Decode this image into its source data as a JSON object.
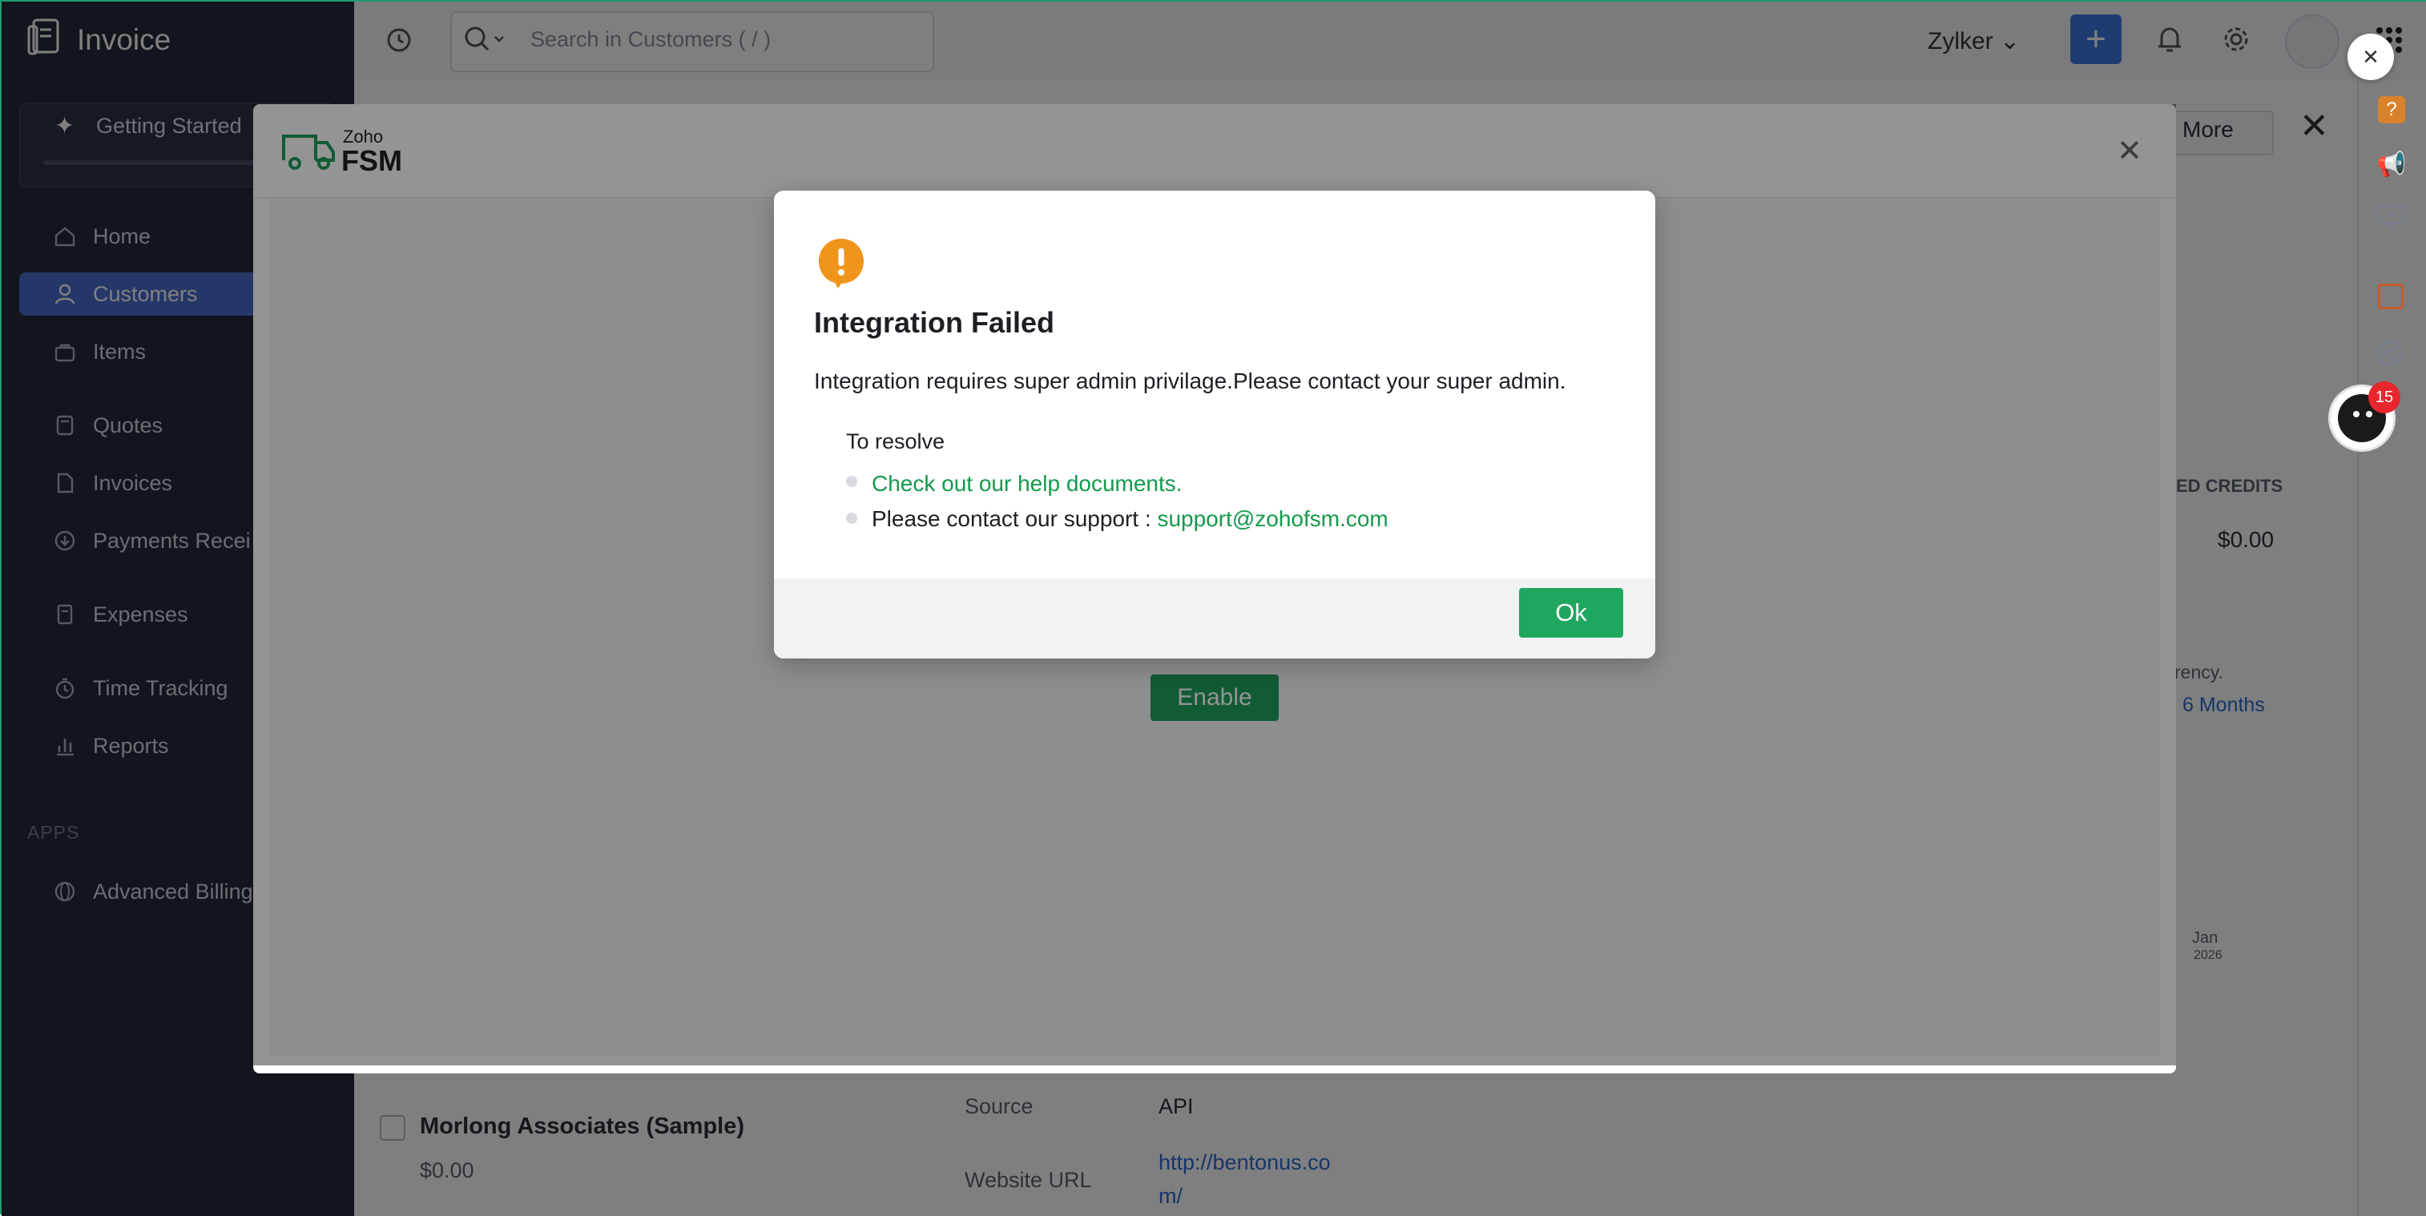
{
  "app": {
    "name": "Invoice"
  },
  "sidebar": {
    "getting_started": "Getting Started",
    "items": [
      {
        "label": "Home",
        "icon": "home-icon"
      },
      {
        "label": "Customers",
        "icon": "user-icon",
        "active": true
      },
      {
        "label": "Items",
        "icon": "bag-icon"
      },
      {
        "label": "Quotes",
        "icon": "calculator-icon"
      },
      {
        "label": "Invoices",
        "icon": "document-icon"
      },
      {
        "label": "Payments Recei",
        "icon": "download-icon"
      },
      {
        "label": "Expenses",
        "icon": "receipt-icon"
      },
      {
        "label": "Time Tracking",
        "icon": "timer-icon"
      },
      {
        "label": "Reports",
        "icon": "bar-chart-icon"
      }
    ],
    "apps_header": "APPS",
    "apps": [
      {
        "label": "Advanced Billing",
        "icon": "globe-icon"
      }
    ]
  },
  "topbar": {
    "search_placeholder": "Search in Customers ( / )",
    "org": "Zylker",
    "new_label": "+"
  },
  "background": {
    "customer_name": "Morlong Associates (Sample)",
    "customer_amount": "$0.00",
    "more_label": "More",
    "credits_header": "ED CREDITS",
    "credits_value": "$0.00",
    "currency_note": "rency.",
    "period": "6 Months",
    "chart_month": "Jan",
    "chart_year": "2026",
    "source_label": "Source",
    "source_value": "API",
    "website_label": "Website URL",
    "website_value_1": "http://bentonus.co",
    "website_value_2": "m/"
  },
  "fsm_modal": {
    "logo_top": "Zoho",
    "logo_bottom": "FSM",
    "enable_label": "Enable"
  },
  "dialog": {
    "title": "Integration Failed",
    "message": "Integration requires super admin privilage.Please contact your super admin.",
    "resolve_label": "To resolve",
    "help_link": "Check out our help documents.",
    "support_text": "Please contact our support : ",
    "support_email": "support@zohofsm.com",
    "ok_label": "Ok"
  },
  "notifications": {
    "bot_badge": "15"
  },
  "colors": {
    "sidebar_bg": "#272b3c",
    "accent_blue": "#4a6fd0",
    "success_green": "#1fa760",
    "warning_orange": "#f0951c",
    "link_green": "#139a4b"
  }
}
